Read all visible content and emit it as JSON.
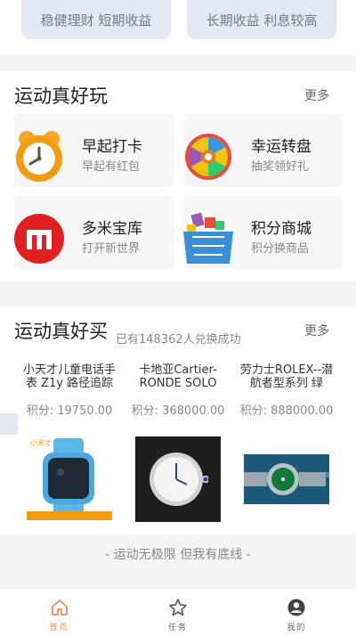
{
  "finance": {
    "left_label": "稳健理财 短期收益",
    "right_label": "长期收益 利息较高"
  },
  "play_section": {
    "title": "运动真好玩",
    "more": "更多",
    "cards": [
      {
        "title": "早起打卡",
        "subtitle": "早起有红包",
        "icon": "alarm-clock-icon"
      },
      {
        "title": "幸运转盘",
        "subtitle": "抽奖领好礼",
        "icon": "lucky-wheel-icon"
      },
      {
        "title": "多米宝库",
        "subtitle": "打开新世界",
        "icon": "treasure-logo-icon"
      },
      {
        "title": "积分商城",
        "subtitle": "积分换商品",
        "icon": "gift-basket-icon"
      }
    ]
  },
  "buy_section": {
    "title": "运动真好买",
    "subtitle": "已有148362人兑换成功",
    "more": "更多",
    "products": [
      {
        "name": "小天才儿童电话手表 Z1y 路径追踪",
        "points": "积分: 19750.00",
        "image": "kids-watch-image"
      },
      {
        "name": "卡地亚Cartier-RONDE SOLO",
        "points": "积分: 368000.00",
        "image": "cartier-watch-image"
      },
      {
        "name": "劳力士ROLEX--潜航者型系列 绿",
        "points": "积分: 888000.00",
        "image": "rolex-watch-image"
      }
    ]
  },
  "footer": {
    "slogan": "- 运动无极限 但我有底线 -"
  },
  "tabbar": {
    "tabs": [
      {
        "label": "首页",
        "icon": "home-icon",
        "active": true
      },
      {
        "label": "任务",
        "icon": "star-icon",
        "active": false
      },
      {
        "label": "我的",
        "icon": "profile-icon",
        "active": false
      }
    ]
  },
  "colors": {
    "accent": "#f08a5d",
    "card_bg": "#f6f6f6",
    "finance_bg": "#e2e9f3"
  }
}
